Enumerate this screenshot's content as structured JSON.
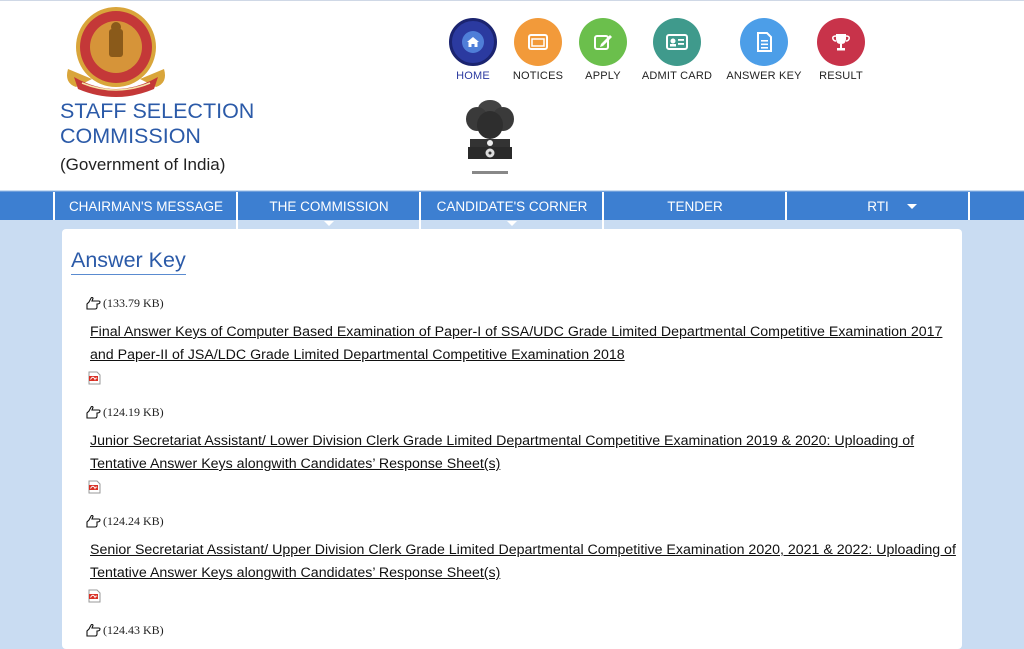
{
  "header": {
    "org_name": "STAFF SELECTION COMMISSION",
    "org_subtitle": "(Government of India)"
  },
  "quick_nav": [
    {
      "label": "HOME",
      "icon": "home-icon",
      "color": "#2b3aa0"
    },
    {
      "label": "NOTICES",
      "icon": "notices-icon",
      "color": "#f29a3a"
    },
    {
      "label": "APPLY",
      "icon": "apply-icon",
      "color": "#6bbf4c"
    },
    {
      "label": "ADMIT CARD",
      "icon": "admit-card-icon",
      "color": "#3f9a8c"
    },
    {
      "label": "ANSWER KEY",
      "icon": "answer-key-icon",
      "color": "#4c9ee8"
    },
    {
      "label": "RESULT",
      "icon": "result-icon",
      "color": "#c8334a"
    }
  ],
  "main_nav": [
    {
      "label": "CHAIRMAN'S MESSAGE"
    },
    {
      "label": "THE COMMISSION"
    },
    {
      "label": "CANDIDATE'S CORNER"
    },
    {
      "label": "TENDER"
    },
    {
      "label": "RTI"
    }
  ],
  "content": {
    "title": "Answer Key",
    "entries": [
      {
        "size": "(133.79 KB)",
        "title": "Final Answer Keys of Computer Based Examination of Paper-I of SSA/UDC Grade Limited Departmental Competitive Examination 2017 and Paper-II of JSA/LDC Grade Limited Departmental Competitive Examination 2018"
      },
      {
        "size": "(124.19 KB)",
        "title": "Junior Secretariat Assistant/ Lower Division Clerk Grade Limited Departmental Competitive Examination 2019 & 2020: Uploading of Tentative Answer Keys alongwith Candidates’ Response Sheet(s)"
      },
      {
        "size": "(124.24 KB)",
        "title": "Senior Secretariat Assistant/ Upper Division Clerk Grade Limited Departmental Competitive Examination 2020, 2021 & 2022: Uploading of Tentative Answer Keys alongwith Candidates’ Response Sheet(s)"
      },
      {
        "size": "(124.43 KB)",
        "title": ""
      }
    ]
  },
  "colors": {
    "nav_bar": "#3d7fd1",
    "page_background": "#c9dcf2",
    "brand_text": "#2b5aa8"
  }
}
